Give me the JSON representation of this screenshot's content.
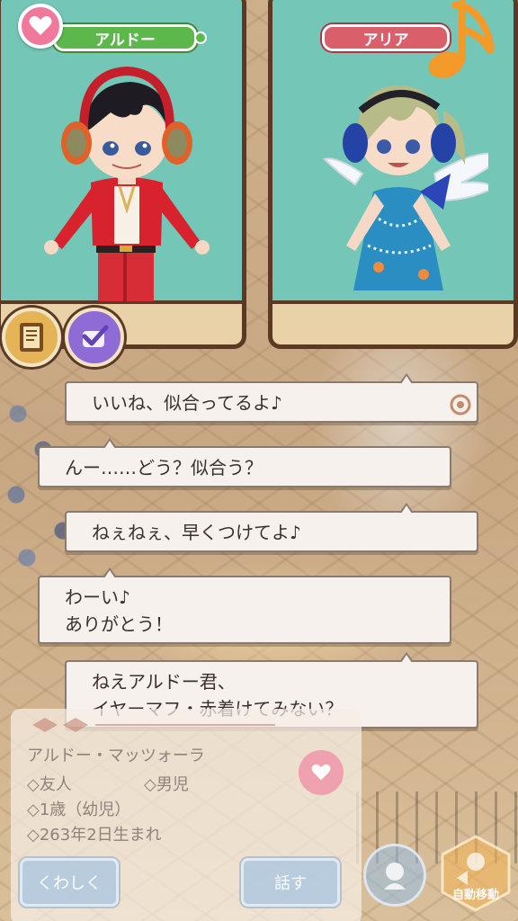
{
  "characters": {
    "left": {
      "name": "アルドー"
    },
    "right": {
      "name": "アリア"
    }
  },
  "icons": {
    "heart_badge": "heart-icon",
    "music_note": "music-note-icon",
    "book": "book-icon",
    "checkmark": "checkmark-icon",
    "speech": "speech-bubble-icon"
  },
  "dialogue": [
    {
      "speaker": "right",
      "lines": [
        "いいね、似合ってるよ♪"
      ]
    },
    {
      "speaker": "left",
      "lines": [
        "んー……どう？似合う？"
      ]
    },
    {
      "speaker": "right",
      "lines": [
        "ねぇねぇ、早くつけてよ♪"
      ]
    },
    {
      "speaker": "left",
      "lines": [
        "わーい♪",
        "ありがとう！"
      ]
    },
    {
      "speaker": "right",
      "lines": [
        "ねえアルドー君、",
        "イヤーマフ・赤着けてみない？"
      ]
    }
  ],
  "profile": {
    "name": "アルドー・マッツォーラ",
    "relation": "◇友人",
    "gender": "◇男児",
    "age": "◇1歳（幼児）",
    "birthday": "◇263年2日生まれ",
    "detail_button": "くわしく",
    "talk_button": "話す"
  },
  "actions": {
    "auto_move_label": "自動移動"
  },
  "colors": {
    "panel_bg": "#74c6b6",
    "panel_border": "#5a3a22",
    "name_green": "#5cb84a",
    "name_red": "#d9606b",
    "heart_pink": "#f0789a",
    "note_orange": "#f39a2a"
  }
}
